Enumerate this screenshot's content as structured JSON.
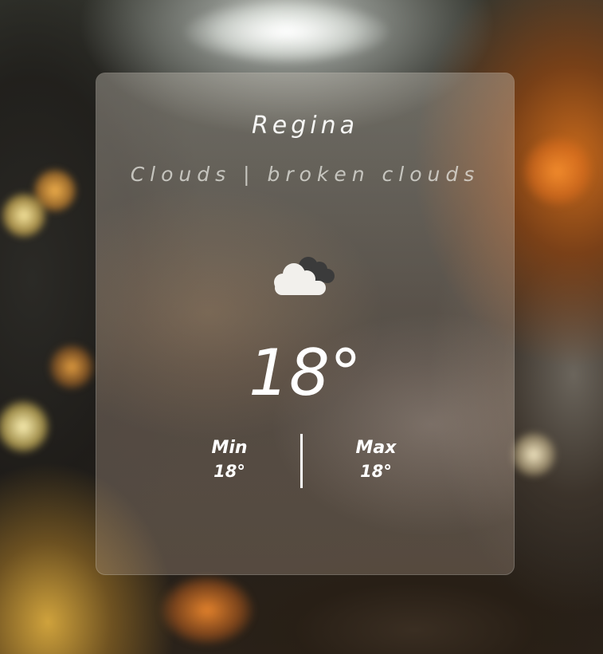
{
  "weather": {
    "city": "Regina",
    "description": "Clouds | broken clouds",
    "icon": "broken-clouds-icon",
    "temperature": "18°",
    "min_label": "Min",
    "min_value": "18°",
    "max_label": "Max",
    "max_value": "18°"
  },
  "colors": {
    "text": "#ffffff",
    "cloud_light": "#f2f0ec",
    "cloud_dark": "#3a3a3a"
  }
}
